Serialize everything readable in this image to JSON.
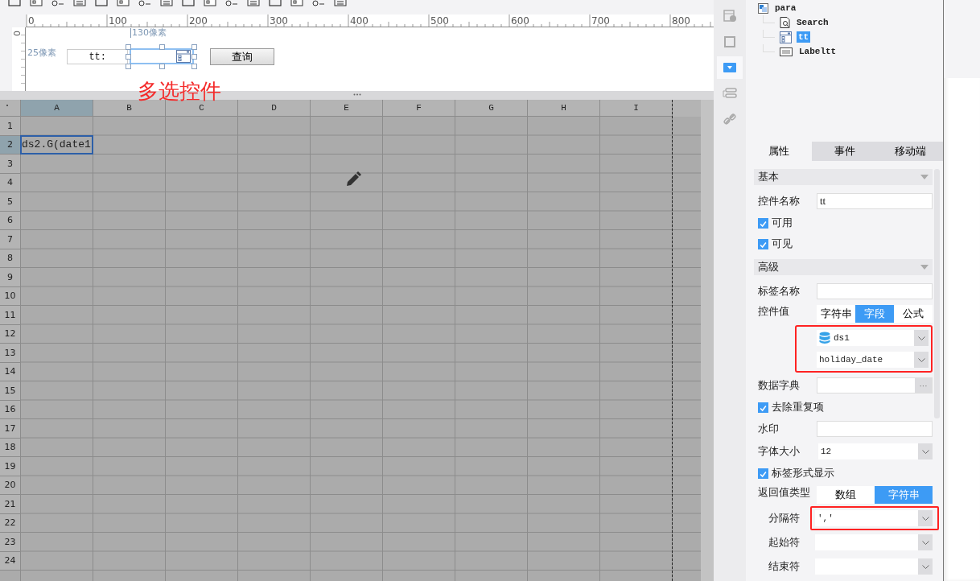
{
  "ruler": {
    "labels": [
      "0",
      "100",
      "200",
      "300",
      "400",
      "500",
      "600",
      "700",
      "800"
    ],
    "vertical_label": "0"
  },
  "form_canvas": {
    "width_hint": "130像素",
    "height_hint": "25像素",
    "label": "tt:",
    "combo_selected": true,
    "button": "查询",
    "annotation": "多选控件"
  },
  "grid": {
    "columns": [
      {
        "label": "A",
        "selected": true
      },
      {
        "label": "B",
        "selected": false
      },
      {
        "label": "C",
        "selected": false
      },
      {
        "label": "D",
        "selected": false
      },
      {
        "label": "E",
        "selected": false
      },
      {
        "label": "F",
        "selected": false
      },
      {
        "label": "G",
        "selected": false
      },
      {
        "label": "H",
        "selected": false
      },
      {
        "label": "I",
        "selected": false
      }
    ],
    "rows": [
      {
        "label": "1",
        "selected": false
      },
      {
        "label": "2",
        "selected": true,
        "cell": {
          "text": "ds2.G(date1",
          "selected": true
        }
      },
      {
        "label": "3",
        "selected": false
      },
      {
        "label": "4",
        "selected": false
      },
      {
        "label": "5",
        "selected": false
      },
      {
        "label": "6",
        "selected": false
      },
      {
        "label": "7",
        "selected": false
      },
      {
        "label": "8",
        "selected": false
      },
      {
        "label": "9",
        "selected": false
      },
      {
        "label": "10",
        "selected": false
      },
      {
        "label": "11",
        "selected": false
      },
      {
        "label": "12",
        "selected": false
      },
      {
        "label": "13",
        "selected": false
      },
      {
        "label": "14",
        "selected": false
      },
      {
        "label": "15",
        "selected": false
      },
      {
        "label": "16",
        "selected": false
      },
      {
        "label": "17",
        "selected": false
      },
      {
        "label": "18",
        "selected": false
      },
      {
        "label": "19",
        "selected": false
      },
      {
        "label": "20",
        "selected": false
      },
      {
        "label": "21",
        "selected": false
      },
      {
        "label": "22",
        "selected": false
      },
      {
        "label": "23",
        "selected": false
      },
      {
        "label": "24",
        "selected": false
      }
    ]
  },
  "side_tools": [
    {
      "selected": false
    },
    {
      "selected": false
    },
    {
      "selected": true
    },
    {
      "selected": false
    },
    {
      "selected": false
    }
  ],
  "tree": {
    "label": "para",
    "children": [
      {
        "label": "Search",
        "selected": false,
        "kind": "search"
      },
      {
        "label": "tt",
        "selected": true,
        "kind": "combo"
      },
      {
        "label": "Labeltt",
        "selected": false,
        "kind": "label"
      }
    ]
  },
  "panel_tabs": [
    {
      "label": "属性",
      "selected": true
    },
    {
      "label": "事件",
      "selected": false
    },
    {
      "label": "移动端",
      "selected": false
    }
  ],
  "sections": [
    {
      "title": "基本",
      "expanded": true,
      "rows": [
        {
          "kind": "text",
          "label": "控件名称",
          "value": "tt"
        },
        {
          "kind": "checkbox",
          "label": "可用",
          "checked": true
        },
        {
          "kind": "checkbox",
          "label": "可见",
          "checked": true
        }
      ]
    },
    {
      "title": "高级",
      "expanded": true,
      "rows": [
        {
          "kind": "text",
          "label": "标签名称"
        },
        {
          "kind": "segmented",
          "label": "控件值",
          "options": [
            {
              "label": "字符串",
              "selected": false
            },
            {
              "label": "字段",
              "selected": true
            },
            {
              "label": "公式",
              "selected": false
            }
          ]
        },
        {
          "kind": "select_group",
          "highlighted": true,
          "selects": [
            {
              "kind": "dataset",
              "value": "ds1"
            },
            {
              "kind": "field",
              "value": "holiday_date"
            }
          ]
        },
        {
          "kind": "dict",
          "label": "数据字典",
          "button": "···"
        },
        {
          "kind": "checkbox",
          "label": "去除重复项",
          "checked": true
        },
        {
          "kind": "text",
          "label": "水印"
        },
        {
          "kind": "select",
          "label": "字体大小",
          "value": "12",
          "sub": false,
          "highlighted": false
        },
        {
          "kind": "checkbox",
          "label": "标签形式显示",
          "checked": true
        },
        {
          "kind": "segmented",
          "label": "返回值类型",
          "options": [
            {
              "label": "数组",
              "selected": false
            },
            {
              "label": "字符串",
              "selected": true
            }
          ]
        },
        {
          "kind": "select",
          "label": "分隔符",
          "value": "','",
          "sub": true,
          "highlighted": true
        },
        {
          "kind": "select",
          "label": "起始符",
          "sub": true,
          "highlighted": false
        },
        {
          "kind": "select",
          "label": "结束符",
          "sub": true,
          "highlighted": false
        }
      ]
    }
  ]
}
